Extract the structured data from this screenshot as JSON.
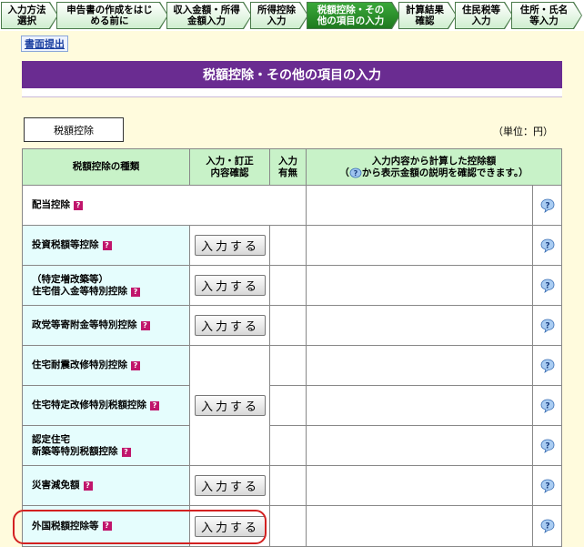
{
  "steps": [
    {
      "label": "入力方法\n選択",
      "active": false
    },
    {
      "label": "申告書の作成をはじ\nめる前に",
      "active": false
    },
    {
      "label": "収入金額・所得\n金額入力",
      "active": false
    },
    {
      "label": "所得控除\n入力",
      "active": false
    },
    {
      "label": "税額控除・その\n他の項目の入力",
      "active": true
    },
    {
      "label": "計算結果\n確認",
      "active": false
    },
    {
      "label": "住民税等\n入力",
      "active": false
    },
    {
      "label": "住所・氏名\n等入力",
      "active": false
    }
  ],
  "doc_link": "書面提出",
  "page_title": "税額控除・その他の項目の入力",
  "section_button": "税額控除",
  "unit": "（単位：円）",
  "table": {
    "headers": {
      "type": "税額控除の種類",
      "entry": "入力・訂正\n内容確認",
      "presence": "入力\n有無",
      "amount_prefix": "入力内容から計算した控除額",
      "amount_open": "（",
      "amount_suffix": "から表示金額の説明を確認できます。）"
    },
    "button_label": "入力する",
    "rows": [
      {
        "name": "配当控除"
      },
      {
        "name": "投資税額等控除"
      },
      {
        "name": "（特定増改築等）\n住宅借入金等特別控除"
      },
      {
        "name": "政党等寄附金等特別控除"
      },
      {
        "name": "住宅耐震改修特別控除"
      },
      {
        "name": "住宅特定改修特別税額控除"
      },
      {
        "name": "認定住宅\n新築等特別税額控除"
      },
      {
        "name": "災害減免額"
      },
      {
        "name": "外国税額控除等"
      }
    ]
  },
  "icons": {
    "help": "help-bubble-icon",
    "badge": "question-badge-icon"
  },
  "colors": {
    "title_bg": "#6a2c91",
    "header_bg": "#c8f2c8",
    "row_bg": "#e5fdfd",
    "highlight": "#d32121",
    "active_step": "#1f7a1f"
  }
}
